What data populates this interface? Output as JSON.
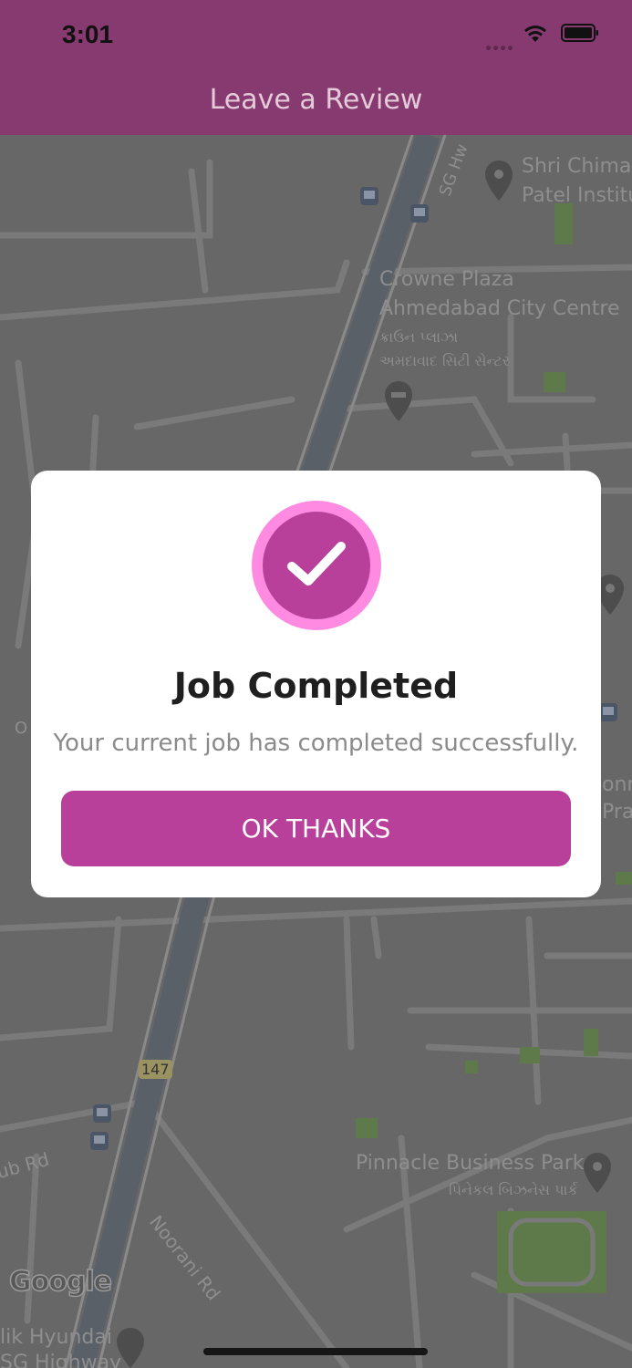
{
  "status_bar": {
    "time": "3:01"
  },
  "header": {
    "title": "Leave a Review"
  },
  "map": {
    "labels": {
      "shri_line1": "Shri Chiman",
      "shri_line2": "Patel Institu",
      "sg_highway": "SG Hw",
      "crowne_line1": "Crowne Plaza",
      "crowne_line2": "Ahmedabad City Centre",
      "crowne_guj1": "ક્રાઉન પ્લાઝા",
      "crowne_guj2": "અમદાવાદ સિટી સેન્ટર",
      "pinnacle": "Pinnacle Business Park",
      "pinnacle_guj": "પિનેકલ બિઝનેસ પાર્ક",
      "noorani": "Noorani Rd",
      "club_rd": "ub Rd",
      "route_147": "147",
      "hyundai_line1": "lik Hyundai",
      "hyundai_line2": "SG Highway",
      "left_edge": "O",
      "right_edge1": "onn",
      "right_edge2": "Pra"
    },
    "logo_text": "Google"
  },
  "dialog": {
    "title": "Job Completed",
    "message": "Your current job has completed successfully.",
    "button_label": "OK THANKS"
  },
  "colors": {
    "header_bg": "#873a70",
    "accent": "#b8409a",
    "check_ring": "#ff8ae2"
  }
}
